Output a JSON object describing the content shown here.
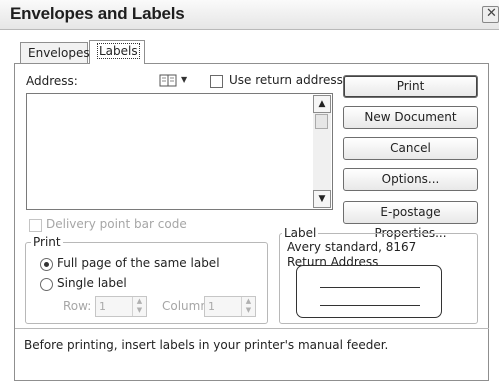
{
  "window": {
    "title": "Envelopes and Labels",
    "close_glyph": "✕"
  },
  "tabs": [
    {
      "label": "Envelopes",
      "active": false
    },
    {
      "label": "Labels",
      "active": true
    }
  ],
  "address": {
    "label": "Address:",
    "value": ""
  },
  "address_book": {
    "icon": "address-book-icon",
    "dropdown_glyph": "▼"
  },
  "use_return_address": {
    "label": "Use return address",
    "checked": false
  },
  "delivery_point_bar_code": {
    "label": "Delivery point bar code",
    "checked": false,
    "enabled": false
  },
  "buttons": {
    "print": "Print",
    "new_document": "New Document",
    "cancel": "Cancel",
    "options": "Options...",
    "epostage": "E-postage Properties..."
  },
  "print_group": {
    "title": "Print",
    "full_page": "Full page of the same label",
    "single_label": "Single label",
    "selected": "full_page",
    "row_label": "Row:",
    "row_value": "1",
    "column_label": "Column:",
    "column_value": "1"
  },
  "label_group": {
    "title": "Label",
    "line1": "Avery standard, 8167",
    "line2": "Return Address"
  },
  "footer_note": "Before printing, insert labels in your printer's manual feeder.",
  "colors": {
    "accent": "#1e1e1e",
    "disabled": "#a6a6a6"
  }
}
